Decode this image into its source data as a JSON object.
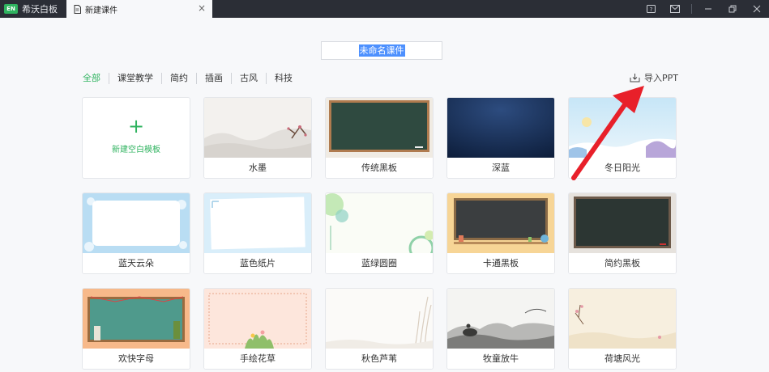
{
  "titlebar": {
    "app_logo": "EN",
    "app_name": "希沃白板",
    "tab_title": "新建课件",
    "tab_close": "×"
  },
  "course_name": "未命名课件",
  "categories": [
    "全部",
    "课堂教学",
    "简约",
    "插画",
    "古风",
    "科技"
  ],
  "active_category": "全部",
  "import_label": "导入PPT",
  "blank_template": {
    "plus": "+",
    "label": "新建空白模板"
  },
  "templates": [
    {
      "label": "水墨"
    },
    {
      "label": "传统黑板"
    },
    {
      "label": "深蓝"
    },
    {
      "label": "冬日阳光"
    },
    {
      "label": "蓝天云朵"
    },
    {
      "label": "蓝色纸片"
    },
    {
      "label": "蓝绿圆圈"
    },
    {
      "label": "卡通黑板"
    },
    {
      "label": "简约黑板"
    },
    {
      "label": "欢快字母"
    },
    {
      "label": "手绘花草"
    },
    {
      "label": "秋色芦苇"
    },
    {
      "label": "牧童放牛"
    },
    {
      "label": "荷塘风光"
    }
  ],
  "colors": {
    "accent": "#2fb35f",
    "annotation_arrow": "#e8202a",
    "titlebar": "#2b2e36"
  }
}
